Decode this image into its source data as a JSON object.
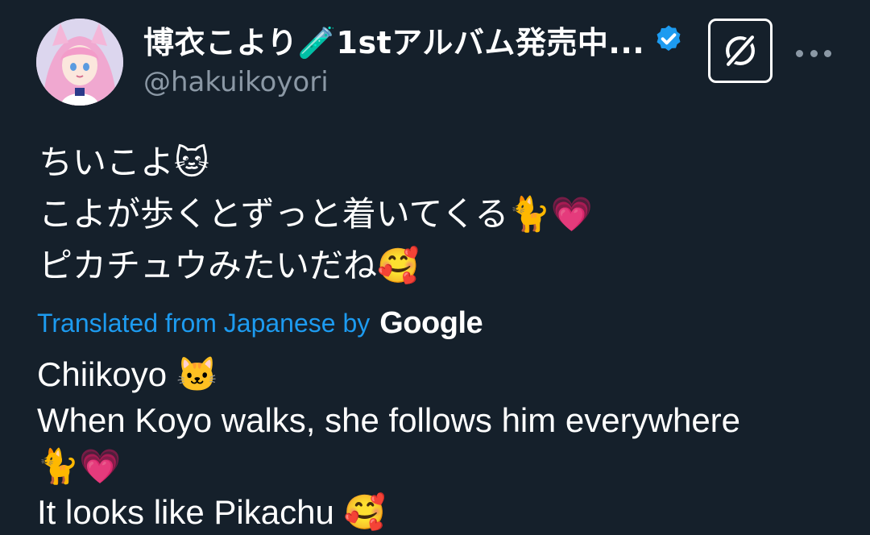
{
  "author": {
    "display_name": "博衣こより🧪1stアルバム発売中...",
    "handle": "@hakuikoyori",
    "verified": true
  },
  "actions": {
    "grok_icon": "grok-icon",
    "more_icon": "more-icon"
  },
  "tweet": {
    "lines": [
      "ちいこよ🐱",
      "こよが歩くとずっと着いてくる🐈💗",
      "ピカチュウみたいだね🥰"
    ]
  },
  "translation": {
    "label": "Translated from Japanese by",
    "provider": "Google",
    "lines": [
      "Chiikoyo 🐱",
      "When Koyo walks, she follows him everywhere",
      "🐈💗",
      "It looks like Pikachu 🥰"
    ]
  },
  "colors": {
    "background": "#15202b",
    "link": "#1d9bf0",
    "secondary_text": "#8b98a5",
    "verified": "#1d9bf0"
  }
}
